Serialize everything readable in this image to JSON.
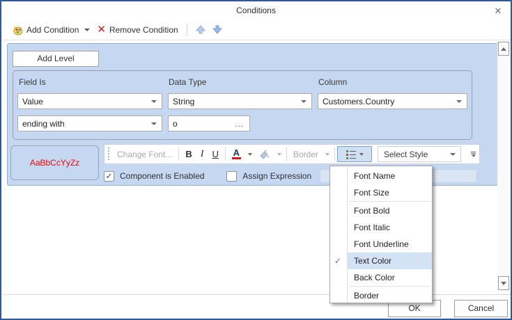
{
  "dialog": {
    "title": "Conditions",
    "close_glyph": "✕"
  },
  "toolbar": {
    "add_condition_label": "Add Condition",
    "remove_condition_label": "Remove Condition",
    "remove_glyph": "✕"
  },
  "panel": {
    "add_level_label": "Add Level",
    "condition": {
      "field_is_label": "Field Is",
      "data_type_label": "Data Type",
      "column_label": "Column",
      "field_is_value": "Value",
      "data_type_value": "String",
      "column_value": "Customers.Country",
      "operator_value": "ending with",
      "operand_value": "o",
      "browse_glyph": "..."
    },
    "format": {
      "preview_text": "AaBbCcYyZz",
      "change_font_label": "Change Font...",
      "bold_glyph": "B",
      "italic_glyph": "I",
      "underline_glyph": "U",
      "text_color_glyph": "A",
      "border_label": "Border",
      "select_style_label": "Select Style",
      "component_enabled_label": "Component is Enabled",
      "component_enabled_check": "✓",
      "assign_expression_label": "Assign Expression"
    }
  },
  "menu": {
    "check_glyph": "✓",
    "items": [
      {
        "label": "Font Name"
      },
      {
        "label": "Font Size"
      },
      {
        "label": "Font Bold"
      },
      {
        "label": "Font Italic"
      },
      {
        "label": "Font Underline"
      },
      {
        "label": "Text Color",
        "checked": true,
        "highlighted": true
      },
      {
        "label": "Back Color"
      },
      {
        "label": "Border"
      }
    ]
  },
  "footer": {
    "ok_label": "OK",
    "cancel_label": "Cancel"
  },
  "colors": {
    "dialog_border": "#2b5a9b",
    "panel_bg": "#c5d7f1",
    "panel_border": "#95add2",
    "menu_highlight": "#d4e2f6",
    "preview_text": "#fb0207",
    "remove_icon": "#cf1b1b",
    "text_color_bar": "#e01414",
    "pressed_button_bg": "#cfe0f5"
  }
}
